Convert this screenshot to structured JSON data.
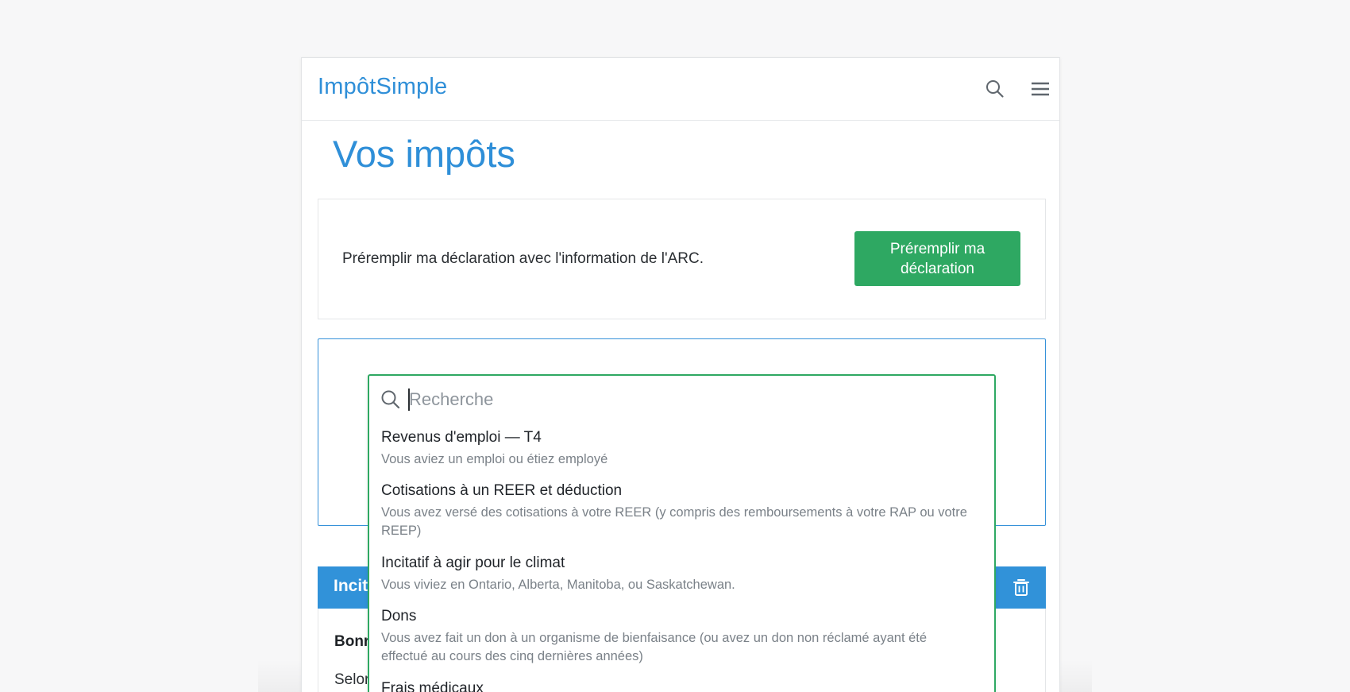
{
  "header": {
    "brand": "ImpôtSimple",
    "search_icon": "search-icon",
    "menu_icon": "hamburger-menu-icon"
  },
  "page": {
    "title": "Vos impôts"
  },
  "prefill": {
    "text": "Préremplir ma déclaration avec l'information de l'ARC.",
    "button_label": "Préremplir ma déclaration"
  },
  "search": {
    "placeholder": "Recherche",
    "value": ""
  },
  "results": [
    {
      "title": "Revenus d'emploi — T4",
      "description": "Vous aviez un emploi ou étiez employé"
    },
    {
      "title": "Cotisations à un REER et déduction",
      "description": "Vous avez versé des cotisations à votre REER (y compris des remboursements à votre RAP ou votre REEP)"
    },
    {
      "title": "Incitatif à agir pour le climat",
      "description": "Vous viviez en Ontario, Alberta, Manitoba, ou Saskatchewan."
    },
    {
      "title": "Dons",
      "description": "Vous avez fait un don à un organisme de bienfaisance (ou avez un don non réclamé ayant été effectué au cours des cinq dernières années)"
    },
    {
      "title": "Frais médicaux",
      "description": ""
    }
  ],
  "incitatif_section": {
    "title": "Incit",
    "bold_text": "Bonr",
    "body_text": "Selor",
    "delete_icon": "trash-icon"
  },
  "colors": {
    "brand_blue": "#2f8fd8",
    "primary_green": "#2ea862",
    "section_blue": "#3192d9"
  }
}
